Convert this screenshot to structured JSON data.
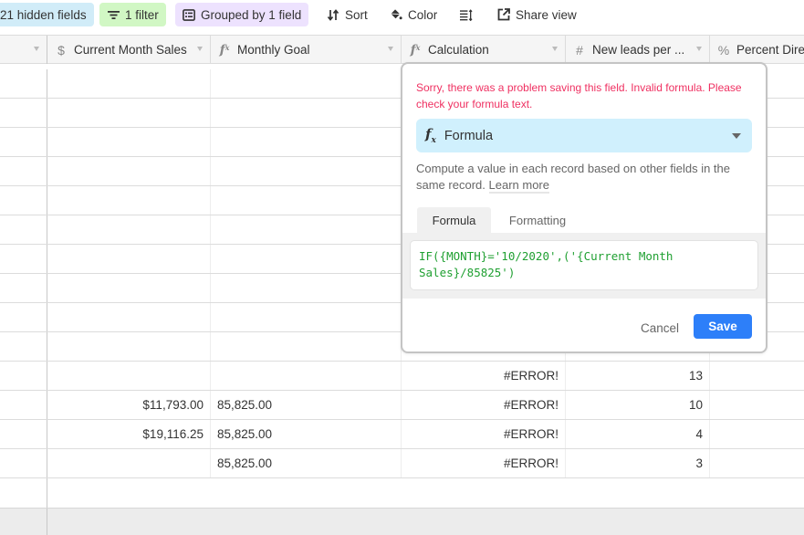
{
  "toolbar": {
    "hidden_fields": "21 hidden fields",
    "filter": "1 filter",
    "group": "Grouped by 1 field",
    "sort": "Sort",
    "color": "Color",
    "share": "Share view",
    "colors": {
      "hidden_bg": "#d1ecf8",
      "filter_bg": "#d1f7c4",
      "group_bg": "#ede2fe"
    }
  },
  "columns": [
    {
      "label": "",
      "icon": "none"
    },
    {
      "label": "Current Month Sales",
      "icon": "currency-icon"
    },
    {
      "label": "Monthly Goal",
      "icon": "formula-icon"
    },
    {
      "label": "Calculation",
      "icon": "formula-icon"
    },
    {
      "label": "New leads per ...",
      "icon": "number-icon"
    },
    {
      "label": "Percent Direc",
      "icon": "percent-icon"
    }
  ],
  "rows": [
    {
      "sales": "",
      "goal": "",
      "calc": "",
      "leads": "",
      "pct": ""
    },
    {
      "sales": "",
      "goal": "",
      "calc": "",
      "leads": "",
      "pct": ""
    },
    {
      "sales": "",
      "goal": "",
      "calc": "",
      "leads": "",
      "pct": ""
    },
    {
      "sales": "",
      "goal": "",
      "calc": "",
      "leads": "",
      "pct": ""
    },
    {
      "sales": "",
      "goal": "",
      "calc": "",
      "leads": "",
      "pct": ""
    },
    {
      "sales": "",
      "goal": "",
      "calc": "",
      "leads": "",
      "pct": ""
    },
    {
      "sales": "",
      "goal": "",
      "calc": "",
      "leads": "",
      "pct": ""
    },
    {
      "sales": "",
      "goal": "",
      "calc": "",
      "leads": "",
      "pct": ""
    },
    {
      "sales": "",
      "goal": "",
      "calc": "",
      "leads": "",
      "pct": ""
    },
    {
      "sales": "",
      "goal": "",
      "calc": "",
      "leads": "",
      "pct": ""
    },
    {
      "sales": "",
      "goal": "",
      "calc": "#ERROR!",
      "leads": "13",
      "pct": ""
    },
    {
      "sales": "$11,793.00",
      "goal": "85,825.00",
      "calc": "#ERROR!",
      "leads": "10",
      "pct": ""
    },
    {
      "sales": "$19,116.25",
      "goal": "85,825.00",
      "calc": "#ERROR!",
      "leads": "4",
      "pct": ""
    },
    {
      "sales": "",
      "goal": "85,825.00",
      "calc": "#ERROR!",
      "leads": "3",
      "pct": ""
    }
  ],
  "popover": {
    "error_message": "Sorry, there was a problem saving this field. Invalid formula. Please check your formula text.",
    "field_type": "Formula",
    "description": "Compute a value in each record based on other fields in the same record.",
    "learn_more": "Learn more",
    "tabs": [
      "Formula",
      "Formatting"
    ],
    "active_tab": "Formula",
    "formula": "IF({MONTH}='10/2020',('{Current Month Sales}/85825')",
    "cancel": "Cancel",
    "save": "Save",
    "colors": {
      "error": "#ef3061",
      "type_bg": "#d0f0fd",
      "formula_text": "#20a032",
      "save_bg": "#2d7ff9"
    }
  }
}
